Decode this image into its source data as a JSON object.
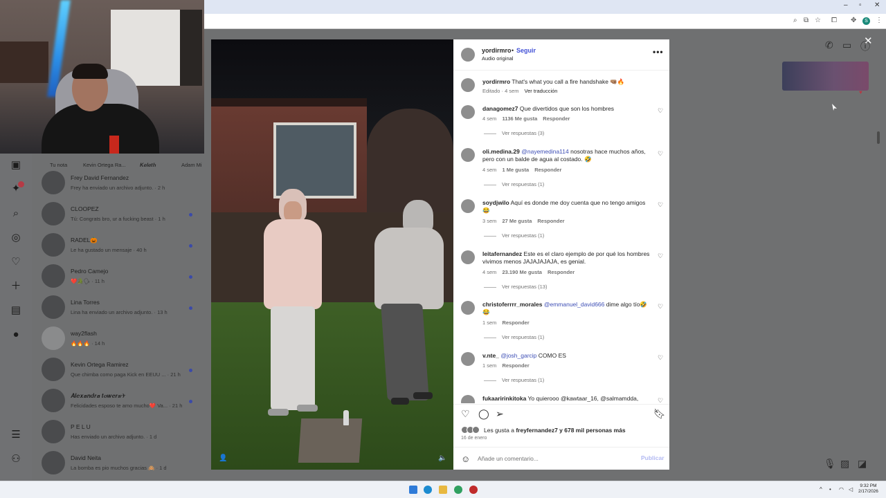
{
  "post": {
    "username": "yordirmro",
    "separator": "•",
    "follow_label": "Seguir",
    "audio_label": "Audio original",
    "more_label": "•••",
    "caption": {
      "user": "yordirmro",
      "text": "That's what you call a fire handshake 🤜🏽🔥",
      "edited_label": "Editado · 4 sem",
      "translate_label": "Ver traducción"
    }
  },
  "comments": [
    {
      "user": "danagomez7",
      "text": "Que divertidos que son los hombres",
      "age": "4 sem",
      "likes": "1136 Me gusta",
      "reply": "Responder",
      "replies": "Ver respuestas (3)"
    },
    {
      "user": "oli.medina.29",
      "mention": "@nayemedina114",
      "text": "nosotras hace muchos años, pero con un balde de agua al costado. 🤣",
      "age": "4 sem",
      "likes": "1 Me gusta",
      "reply": "Responder",
      "replies": "Ver respuestas (1)"
    },
    {
      "user": "soydjwilo",
      "text": "Aquí es donde me doy cuenta que no tengo amigos 😂",
      "age": "3 sem",
      "likes": "27 Me gusta",
      "reply": "Responder",
      "replies": "Ver respuestas (1)"
    },
    {
      "user": "leitafernandez",
      "text": "Este es el claro ejemplo de por qué los hombres vivimos menos JAJAJAJAJA, es genial.",
      "age": "4 sem",
      "likes": "23.190 Me gusta",
      "reply": "Responder",
      "replies": "Ver respuestas (13)"
    },
    {
      "user": "christoferrrr_morales",
      "mention": "@emmanuel_david666",
      "text": "dime algo tío🤣😂",
      "age": "1 sem",
      "likes": "",
      "reply": "Responder",
      "replies": "Ver respuestas (1)"
    },
    {
      "user": "v.nte_",
      "mention": "@josh_garcip",
      "text": "COMO ES",
      "age": "1 sem",
      "likes": "",
      "reply": "Responder",
      "replies": "Ver respuestas (1)"
    },
    {
      "user": "fukaaririnkitoka",
      "mention": "",
      "text": "Yo quierooo @kawtaar_16, @salmamdda,",
      "age": "",
      "likes": "",
      "reply": "",
      "replies": ""
    }
  ],
  "likes_summary": {
    "prefix": "Les gusta a",
    "user": "freyfernandez7",
    "suffix": "y 678 mil personas más"
  },
  "post_date": "16 de enero",
  "comment_box": {
    "placeholder": "Añade un comentario...",
    "publish_label": "Publicar"
  },
  "icons": {
    "heart": "heart-icon",
    "comment": "comment-icon",
    "share": "share-icon",
    "bookmark": "bookmark-icon",
    "emoji": "emoji-icon",
    "close": "close-icon"
  },
  "stories": [
    "Tu nota",
    "Kevin Ortega Ra...",
    "𝑲𝒆𝒍𝒆𝒕𝒉",
    "Adam Mi"
  ],
  "chats": [
    {
      "name": "Frey David Fernandez",
      "preview": "Frey ha enviado un archivo adjunto. · 2 h",
      "unread": false
    },
    {
      "name": "CLOOPEZ",
      "preview": "Tú: Congrats bro, ur a fucking beast · 1 h",
      "unread": true
    },
    {
      "name": "RADEL🎃",
      "preview": "Le ha gustado un mensaje · 40 h",
      "unread": true
    },
    {
      "name": "Pedro Camejo",
      "preview": "❤️🐊🗣 · 11 h",
      "unread": true
    },
    {
      "name": "Lina Torres",
      "preview": "Lina ha enviado un archivo adjunto. · 13 h",
      "unread": true
    },
    {
      "name": "way2flash",
      "preview": "🔥🔥🔥 · 14 h",
      "unread": false
    },
    {
      "name": "Kevin Ortega Ramirez",
      "preview": "Que chimba como paga Kick en EEUU ... · 21 h",
      "unread": true
    },
    {
      "name": "𝑨𝒍𝒆𝒙𝒂𝒏𝒅𝒓𝒂 𝒕𝒐𝒘𝒆𝒓𝒔✈",
      "preview": "Felicidades esposo te amo mucho❤️ Va... · 21 h",
      "unread": true
    },
    {
      "name": "P E L U",
      "preview": "Has enviado un archivo adjunto. · 1 d",
      "unread": false
    },
    {
      "name": "David Neita",
      "preview": "La bomba es pio muchos gracias 🙈 · 1 d",
      "unread": false
    }
  ],
  "taskbar": {
    "time": "9:32 PM",
    "date": "2/17/2026"
  },
  "colors": {
    "follow": "#4150d6",
    "mention": "#3d4eb5",
    "publish_disabled": "#b2b9f2",
    "unread_dot": "#3b4aa8"
  }
}
